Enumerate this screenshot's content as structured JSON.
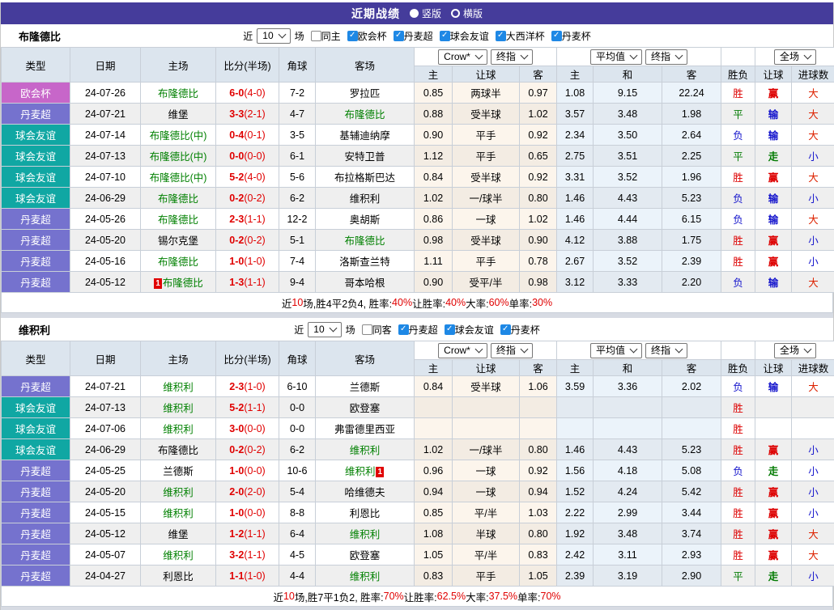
{
  "banner": {
    "title": "近期战绩",
    "options": [
      {
        "label": "竖版",
        "selected": false
      },
      {
        "label": "横版",
        "selected": true
      }
    ]
  },
  "colors": {
    "banner_bg": "#453C9B",
    "header_bg": "#DCE5EE",
    "type_colors": {
      "欧会杯": "#C766C9",
      "丹麦超": "#7572CE",
      "球会友谊": "#10A7A3"
    },
    "result_colors": {
      "胜": "#DD0000",
      "平": "#007A00",
      "负": "#1414CC",
      "赢": "#DD0000",
      "输": "#1414CC",
      "走": "#007A00",
      "大": "#DD2200",
      "小": "#1414CC"
    },
    "team_highlight": "#008000",
    "score_color": "#E00000"
  },
  "columns": {
    "main": [
      "类型",
      "日期",
      "主场",
      "比分(半场)",
      "角球",
      "客场"
    ],
    "sub": [
      "主",
      "让球",
      "客",
      "主",
      "和",
      "客",
      "胜负",
      "让球",
      "进球数"
    ],
    "selects": {
      "odds_source": "Crow*",
      "odds_final": "终指",
      "avg": "平均值",
      "avg_final": "终指",
      "scope": "全场"
    }
  },
  "sections": [
    {
      "team": "布隆德比",
      "filter": {
        "near_label": "近",
        "match_count": "10",
        "games_label": "场",
        "same_checkbox": {
          "label": "同主",
          "checked": false
        },
        "league_checkboxes": [
          {
            "label": "欧会杯",
            "checked": true
          },
          {
            "label": "丹麦超",
            "checked": true
          },
          {
            "label": "球会友谊",
            "checked": true
          },
          {
            "label": "大西洋杯",
            "checked": true
          },
          {
            "label": "丹麦杯",
            "checked": true
          }
        ]
      },
      "rows": [
        {
          "type": "欧会杯",
          "date": "24-07-26",
          "home": "布隆德比",
          "home_green": true,
          "home_badge": "",
          "score": "6-0",
          "half": "(4-0)",
          "corner": "7-2",
          "away": "罗拉匹",
          "away_green": false,
          "away_badge": "",
          "odds": [
            "0.85",
            "两球半",
            "0.97"
          ],
          "avg": [
            "1.08",
            "9.15",
            "22.24"
          ],
          "results": [
            "胜",
            "赢",
            "大"
          ]
        },
        {
          "type": "丹麦超",
          "date": "24-07-21",
          "home": "维堡",
          "home_green": false,
          "home_badge": "",
          "score": "3-3",
          "half": "(2-1)",
          "corner": "4-7",
          "away": "布隆德比",
          "away_green": true,
          "away_badge": "",
          "odds": [
            "0.88",
            "受半球",
            "1.02"
          ],
          "avg": [
            "3.57",
            "3.48",
            "1.98"
          ],
          "results": [
            "平",
            "输",
            "大"
          ]
        },
        {
          "type": "球会友谊",
          "date": "24-07-14",
          "home": "布隆德比(中)",
          "home_green": true,
          "home_badge": "",
          "score": "0-4",
          "half": "(0-1)",
          "corner": "3-5",
          "away": "基辅迪纳摩",
          "away_green": false,
          "away_badge": "",
          "odds": [
            "0.90",
            "平手",
            "0.92"
          ],
          "avg": [
            "2.34",
            "3.50",
            "2.64"
          ],
          "results": [
            "负",
            "输",
            "大"
          ]
        },
        {
          "type": "球会友谊",
          "date": "24-07-13",
          "home": "布隆德比(中)",
          "home_green": true,
          "home_badge": "",
          "score": "0-0",
          "half": "(0-0)",
          "corner": "6-1",
          "away": "安特卫普",
          "away_green": false,
          "away_badge": "",
          "odds": [
            "1.12",
            "平手",
            "0.65"
          ],
          "avg": [
            "2.75",
            "3.51",
            "2.25"
          ],
          "results": [
            "平",
            "走",
            "小"
          ]
        },
        {
          "type": "球会友谊",
          "date": "24-07-10",
          "home": "布隆德比(中)",
          "home_green": true,
          "home_badge": "",
          "score": "5-2",
          "half": "(4-0)",
          "corner": "5-6",
          "away": "布拉格斯巴达",
          "away_green": false,
          "away_badge": "",
          "odds": [
            "0.84",
            "受半球",
            "0.92"
          ],
          "avg": [
            "3.31",
            "3.52",
            "1.96"
          ],
          "results": [
            "胜",
            "赢",
            "大"
          ]
        },
        {
          "type": "球会友谊",
          "date": "24-06-29",
          "home": "布隆德比",
          "home_green": true,
          "home_badge": "",
          "score": "0-2",
          "half": "(0-2)",
          "corner": "6-2",
          "away": "维积利",
          "away_green": false,
          "away_badge": "",
          "odds": [
            "1.02",
            "一/球半",
            "0.80"
          ],
          "avg": [
            "1.46",
            "4.43",
            "5.23"
          ],
          "results": [
            "负",
            "输",
            "小"
          ]
        },
        {
          "type": "丹麦超",
          "date": "24-05-26",
          "home": "布隆德比",
          "home_green": true,
          "home_badge": "",
          "score": "2-3",
          "half": "(1-1)",
          "corner": "12-2",
          "away": "奥胡斯",
          "away_green": false,
          "away_badge": "",
          "odds": [
            "0.86",
            "一球",
            "1.02"
          ],
          "avg": [
            "1.46",
            "4.44",
            "6.15"
          ],
          "results": [
            "负",
            "输",
            "大"
          ]
        },
        {
          "type": "丹麦超",
          "date": "24-05-20",
          "home": "锡尔克堡",
          "home_green": false,
          "home_badge": "",
          "score": "0-2",
          "half": "(0-2)",
          "corner": "5-1",
          "away": "布隆德比",
          "away_green": true,
          "away_badge": "",
          "odds": [
            "0.98",
            "受半球",
            "0.90"
          ],
          "avg": [
            "4.12",
            "3.88",
            "1.75"
          ],
          "results": [
            "胜",
            "赢",
            "小"
          ]
        },
        {
          "type": "丹麦超",
          "date": "24-05-16",
          "home": "布隆德比",
          "home_green": true,
          "home_badge": "",
          "score": "1-0",
          "half": "(1-0)",
          "corner": "7-4",
          "away": "洛斯查兰特",
          "away_green": false,
          "away_badge": "",
          "odds": [
            "1.11",
            "平手",
            "0.78"
          ],
          "avg": [
            "2.67",
            "3.52",
            "2.39"
          ],
          "results": [
            "胜",
            "赢",
            "小"
          ]
        },
        {
          "type": "丹麦超",
          "date": "24-05-12",
          "home": "布隆德比",
          "home_green": true,
          "home_badge": "1",
          "score": "1-3",
          "half": "(1-1)",
          "corner": "9-4",
          "away": "哥本哈根",
          "away_green": false,
          "away_badge": "",
          "odds": [
            "0.90",
            "受平/半",
            "0.98"
          ],
          "avg": [
            "3.12",
            "3.33",
            "2.20"
          ],
          "results": [
            "负",
            "输",
            "大"
          ]
        }
      ],
      "summary": [
        {
          "text": "近",
          "red": false
        },
        {
          "text": "10",
          "red": true
        },
        {
          "text": "场,胜4平2负4, 胜率:",
          "red": false
        },
        {
          "text": "40%",
          "red": true
        },
        {
          "text": " 让胜率:",
          "red": false
        },
        {
          "text": "40%",
          "red": true
        },
        {
          "text": " 大率:",
          "red": false
        },
        {
          "text": "60%",
          "red": true
        },
        {
          "text": " 单率:",
          "red": false
        },
        {
          "text": "30%",
          "red": true
        }
      ]
    },
    {
      "team": "维积利",
      "filter": {
        "near_label": "近",
        "match_count": "10",
        "games_label": "场",
        "same_checkbox": {
          "label": "同客",
          "checked": false
        },
        "league_checkboxes": [
          {
            "label": "丹麦超",
            "checked": true
          },
          {
            "label": "球会友谊",
            "checked": true
          },
          {
            "label": "丹麦杯",
            "checked": true
          }
        ]
      },
      "rows": [
        {
          "type": "丹麦超",
          "date": "24-07-21",
          "home": "维积利",
          "home_green": true,
          "home_badge": "",
          "score": "2-3",
          "half": "(1-0)",
          "corner": "6-10",
          "away": "兰德斯",
          "away_green": false,
          "away_badge": "",
          "odds": [
            "0.84",
            "受半球",
            "1.06"
          ],
          "avg": [
            "3.59",
            "3.36",
            "2.02"
          ],
          "results": [
            "负",
            "输",
            "大"
          ]
        },
        {
          "type": "球会友谊",
          "date": "24-07-13",
          "home": "维积利",
          "home_green": true,
          "home_badge": "",
          "score": "5-2",
          "half": "(1-1)",
          "corner": "0-0",
          "away": "欧登塞",
          "away_green": false,
          "away_badge": "",
          "odds": [
            "",
            "",
            ""
          ],
          "avg": [
            "",
            "",
            ""
          ],
          "results": [
            "胜",
            "",
            ""
          ]
        },
        {
          "type": "球会友谊",
          "date": "24-07-06",
          "home": "维积利",
          "home_green": true,
          "home_badge": "",
          "score": "3-0",
          "half": "(0-0)",
          "corner": "0-0",
          "away": "弗雷德里西亚",
          "away_green": false,
          "away_badge": "",
          "odds": [
            "",
            "",
            ""
          ],
          "avg": [
            "",
            "",
            ""
          ],
          "results": [
            "胜",
            "",
            ""
          ]
        },
        {
          "type": "球会友谊",
          "date": "24-06-29",
          "home": "布隆德比",
          "home_green": false,
          "home_badge": "",
          "score": "0-2",
          "half": "(0-2)",
          "corner": "6-2",
          "away": "维积利",
          "away_green": true,
          "away_badge": "",
          "odds": [
            "1.02",
            "一/球半",
            "0.80"
          ],
          "avg": [
            "1.46",
            "4.43",
            "5.23"
          ],
          "results": [
            "胜",
            "赢",
            "小"
          ]
        },
        {
          "type": "丹麦超",
          "date": "24-05-25",
          "home": "兰德斯",
          "home_green": false,
          "home_badge": "",
          "score": "1-0",
          "half": "(0-0)",
          "corner": "10-6",
          "away": "维积利",
          "away_green": true,
          "away_badge": "1",
          "odds": [
            "0.96",
            "一球",
            "0.92"
          ],
          "avg": [
            "1.56",
            "4.18",
            "5.08"
          ],
          "results": [
            "负",
            "走",
            "小"
          ]
        },
        {
          "type": "丹麦超",
          "date": "24-05-20",
          "home": "维积利",
          "home_green": true,
          "home_badge": "",
          "score": "2-0",
          "half": "(2-0)",
          "corner": "5-4",
          "away": "哈维德夫",
          "away_green": false,
          "away_badge": "",
          "odds": [
            "0.94",
            "一球",
            "0.94"
          ],
          "avg": [
            "1.52",
            "4.24",
            "5.42"
          ],
          "results": [
            "胜",
            "赢",
            "小"
          ]
        },
        {
          "type": "丹麦超",
          "date": "24-05-15",
          "home": "维积利",
          "home_green": true,
          "home_badge": "",
          "score": "1-0",
          "half": "(0-0)",
          "corner": "8-8",
          "away": "利恩比",
          "away_green": false,
          "away_badge": "",
          "odds": [
            "0.85",
            "平/半",
            "1.03"
          ],
          "avg": [
            "2.22",
            "2.99",
            "3.44"
          ],
          "results": [
            "胜",
            "赢",
            "小"
          ]
        },
        {
          "type": "丹麦超",
          "date": "24-05-12",
          "home": "维堡",
          "home_green": false,
          "home_badge": "",
          "score": "1-2",
          "half": "(1-1)",
          "corner": "6-4",
          "away": "维积利",
          "away_green": true,
          "away_badge": "",
          "odds": [
            "1.08",
            "半球",
            "0.80"
          ],
          "avg": [
            "1.92",
            "3.48",
            "3.74"
          ],
          "results": [
            "胜",
            "赢",
            "大"
          ]
        },
        {
          "type": "丹麦超",
          "date": "24-05-07",
          "home": "维积利",
          "home_green": true,
          "home_badge": "",
          "score": "3-2",
          "half": "(1-1)",
          "corner": "4-5",
          "away": "欧登塞",
          "away_green": false,
          "away_badge": "",
          "odds": [
            "1.05",
            "平/半",
            "0.83"
          ],
          "avg": [
            "2.42",
            "3.11",
            "2.93"
          ],
          "results": [
            "胜",
            "赢",
            "大"
          ]
        },
        {
          "type": "丹麦超",
          "date": "24-04-27",
          "home": "利恩比",
          "home_green": false,
          "home_badge": "",
          "score": "1-1",
          "half": "(1-0)",
          "corner": "4-4",
          "away": "维积利",
          "away_green": true,
          "away_badge": "",
          "odds": [
            "0.83",
            "平手",
            "1.05"
          ],
          "avg": [
            "2.39",
            "3.19",
            "2.90"
          ],
          "results": [
            "平",
            "走",
            "小"
          ]
        }
      ],
      "summary": [
        {
          "text": "近",
          "red": false
        },
        {
          "text": "10",
          "red": true
        },
        {
          "text": "场,胜7平1负2, 胜率:",
          "red": false
        },
        {
          "text": "70%",
          "red": true
        },
        {
          "text": " 让胜率:",
          "red": false
        },
        {
          "text": "62.5%",
          "red": true
        },
        {
          "text": " 大率:",
          "red": false
        },
        {
          "text": "37.5%",
          "red": true
        },
        {
          "text": " 单率:",
          "red": false
        },
        {
          "text": "70%",
          "red": true
        }
      ]
    }
  ]
}
